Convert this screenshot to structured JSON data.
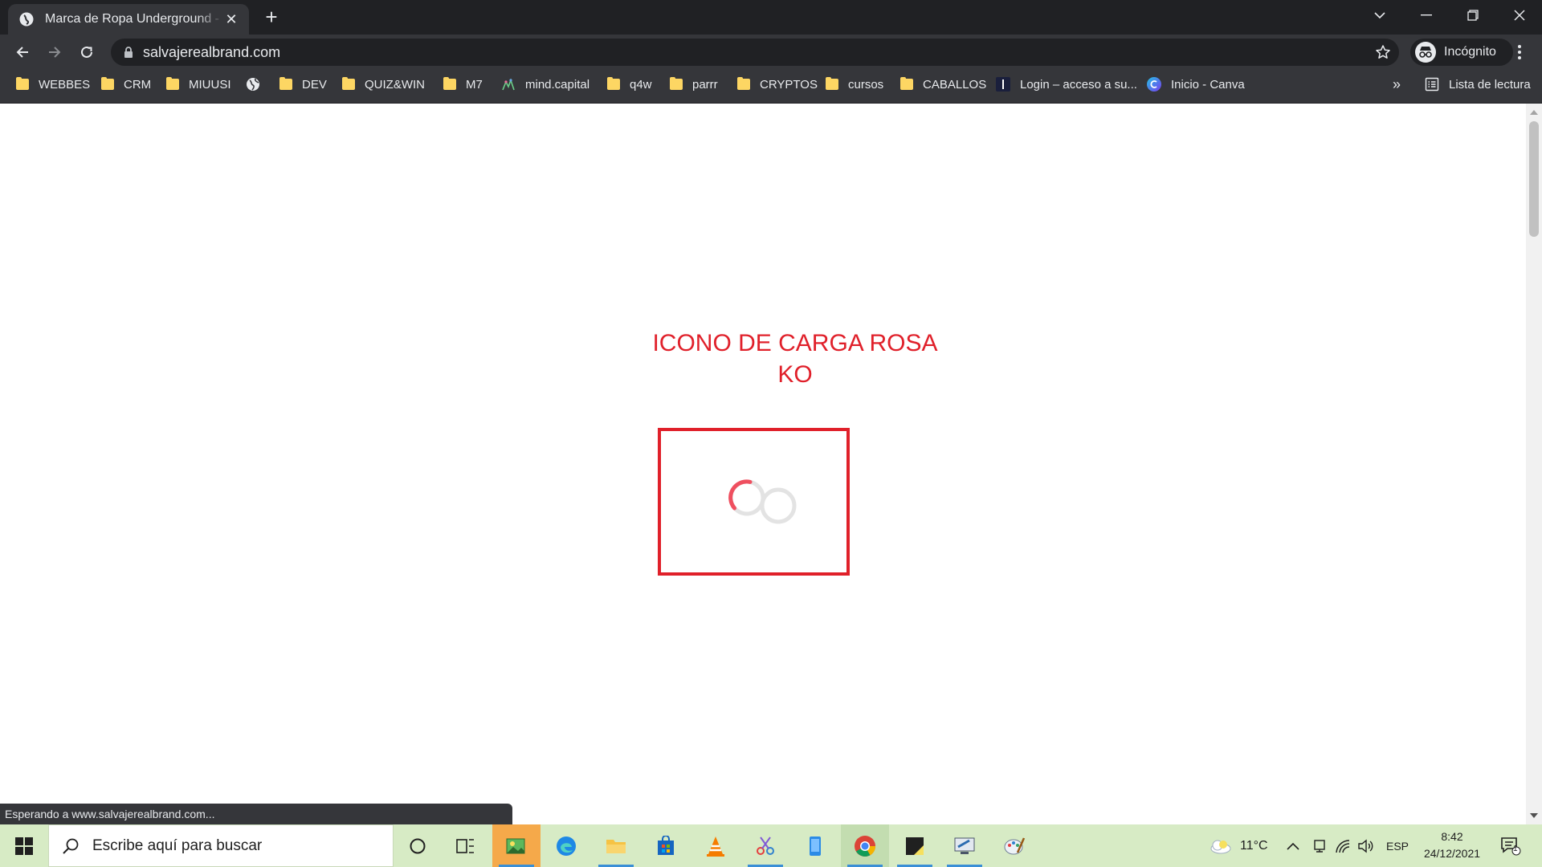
{
  "browser": {
    "tab": {
      "title": "Marca de Ropa Underground - Salvaje Real Brand",
      "close_glyph": "✕"
    },
    "newtab_glyph": "+",
    "url": "salvajerealbrand.com",
    "incognito_label": "Incógnito",
    "bookmarks": [
      {
        "label": "WEBBES",
        "icon": "folder-icon"
      },
      {
        "label": "CRM",
        "icon": "folder-icon"
      },
      {
        "label": "MIUUSI",
        "icon": "folder-icon"
      },
      {
        "label": "",
        "icon": "globe-icon"
      },
      {
        "label": "DEV",
        "icon": "folder-icon"
      },
      {
        "label": "QUIZ&WIN",
        "icon": "folder-icon"
      },
      {
        "label": "M7",
        "icon": "folder-icon"
      },
      {
        "label": "mind.capital",
        "icon": "mind-capital-icon"
      },
      {
        "label": "q4w",
        "icon": "folder-icon"
      },
      {
        "label": "parrr",
        "icon": "folder-icon"
      },
      {
        "label": "CRYPTOS",
        "icon": "folder-icon"
      },
      {
        "label": "cursos",
        "icon": "folder-icon"
      },
      {
        "label": "CABALLOS",
        "icon": "folder-icon"
      },
      {
        "label": "Login – acceso a su...",
        "icon": "login-site-icon"
      },
      {
        "label": "Inicio - Canva",
        "icon": "canva-icon"
      }
    ],
    "bookmarks_overflow": "»",
    "reading_list_label": "Lista de lectura",
    "status_text": "Esperando a www.salvajerealbrand.com..."
  },
  "page": {
    "headline_line1": "ICONO DE CARGA ROSA",
    "headline_line2": "KO"
  },
  "colors": {
    "annotation_red": "#e0202a",
    "spinner_pink": "#ef4f5f",
    "spinner_grey": "#e3e3e3"
  },
  "taskbar": {
    "search_placeholder": "Escribe aquí para buscar",
    "weather": "11°C",
    "language": "ESP",
    "time": "8:42",
    "date": "24/12/2021",
    "notification_count": "1"
  }
}
